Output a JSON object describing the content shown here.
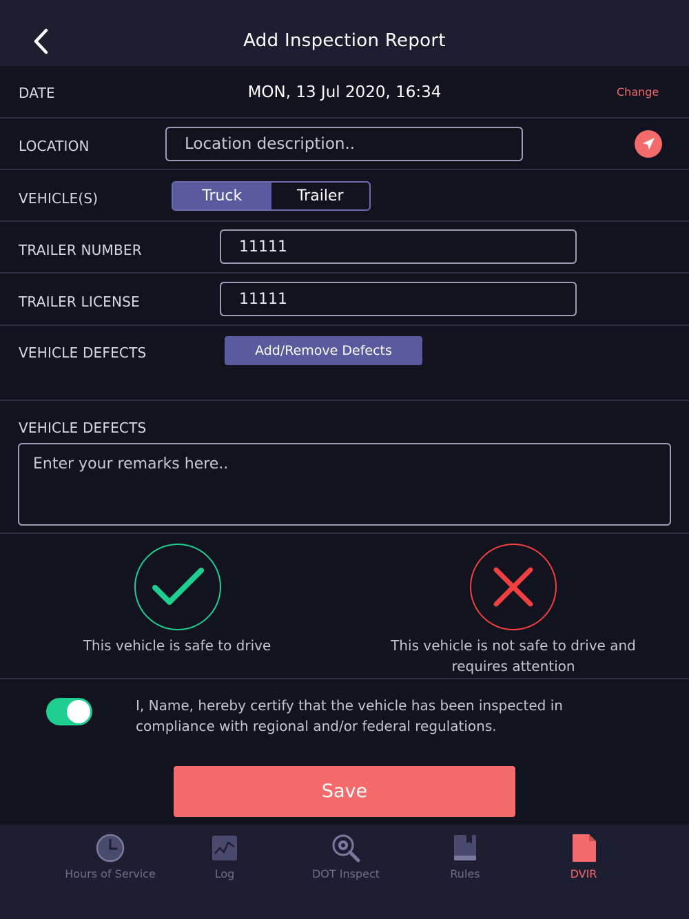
{
  "header": {
    "title": "Add Inspection Report",
    "back_icon": "chevron-left-icon"
  },
  "date": {
    "label": "DATE",
    "value": "MON, 13 Jul 2020, 16:34",
    "change_label": "Change"
  },
  "location": {
    "label": "LOCATION",
    "placeholder": "Location description..",
    "value": "",
    "locate_icon": "navigation-arrow-icon"
  },
  "vehicles": {
    "label": "VEHICLE(S)",
    "options": [
      "Truck",
      "Trailer"
    ],
    "selected": "Truck"
  },
  "trailer_number": {
    "label": "TRAILER NUMBER",
    "value": "11111"
  },
  "trailer_license": {
    "label": "TRAILER LICENSE",
    "value": "11111"
  },
  "defects": {
    "label": "VEHICLE DEFECTS",
    "button_label": "Add/Remove Defects"
  },
  "remarks": {
    "label": "VEHICLE DEFECTS",
    "placeholder": "Enter your remarks here..",
    "value": ""
  },
  "status": {
    "safe": {
      "text": "This vehicle is safe to drive",
      "icon": "checkmark-icon",
      "color": "#1fcf8f"
    },
    "unsafe": {
      "text": "This vehicle is not safe to drive and requires attention",
      "icon": "x-icon",
      "color": "#f04040"
    }
  },
  "certification": {
    "enabled": true,
    "text": "I, Name, hereby certify that the vehicle has been inspected in compliance with regional and/or federal regulations."
  },
  "save_label": "Save",
  "tabs": [
    {
      "label": "Hours of Service",
      "icon": "clock-icon"
    },
    {
      "label": "Log",
      "icon": "log-chart-icon"
    },
    {
      "label": "DOT Inspect",
      "icon": "inspect-magnifier-icon"
    },
    {
      "label": "Rules",
      "icon": "book-icon"
    },
    {
      "label": "DVIR",
      "icon": "document-icon",
      "active": true
    }
  ],
  "colors": {
    "accent": "#f56a6a",
    "primary": "#5a5a9e",
    "background": "#13131f",
    "bar": "#1e1e33",
    "success": "#1fcf8f"
  }
}
